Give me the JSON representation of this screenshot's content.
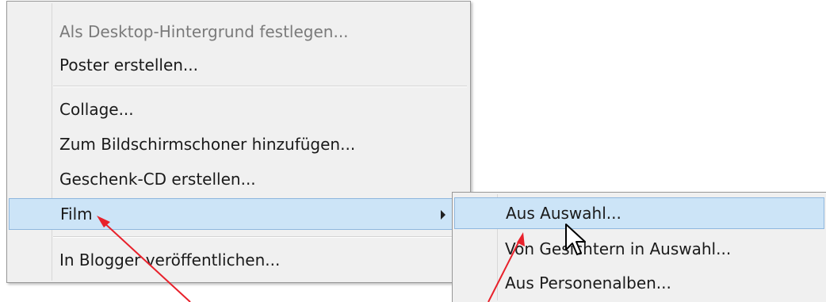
{
  "main_menu": {
    "items": [
      {
        "label": "Als Desktop-Hintergrund festlegen..."
      },
      {
        "label": "Poster erstellen..."
      },
      {
        "label": "Collage..."
      },
      {
        "label": "Zum Bildschirmschoner hinzufügen..."
      },
      {
        "label": "Geschenk-CD erstellen..."
      },
      {
        "label": "Film"
      },
      {
        "label": "In Blogger veröffentlichen..."
      }
    ]
  },
  "sub_menu": {
    "items": [
      {
        "label": "Aus Auswahl..."
      },
      {
        "label": "Von Gesichtern in Auswahl..."
      },
      {
        "label": "Aus Personenalben..."
      }
    ]
  },
  "colors": {
    "highlight": "#cce4f7",
    "menu_background": "#f0f0f0",
    "annotation_arrow": "#e8212b"
  },
  "icons": {
    "submenu_arrow": "chevron-right-icon",
    "mouse_pointer": "mouse-cursor-icon",
    "annotation": "red-arrow-icon"
  }
}
